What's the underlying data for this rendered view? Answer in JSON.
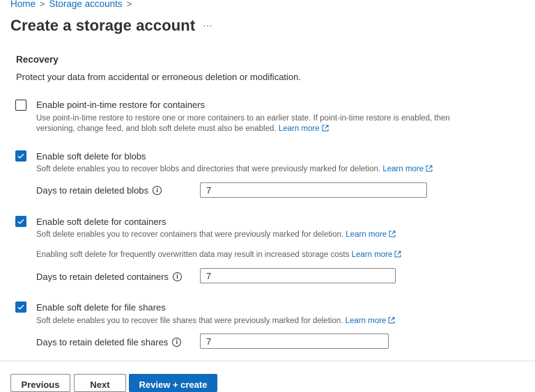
{
  "breadcrumb": {
    "home": "Home",
    "storage": "Storage accounts"
  },
  "page": {
    "title": "Create a storage account",
    "more": "···"
  },
  "recovery": {
    "title": "Recovery",
    "description": "Protect your data from accidental or erroneous deletion or modification.",
    "pitr": {
      "label": "Enable point-in-time restore for containers",
      "checked": false,
      "help": "Use point-in-time restore to restore one or more containers to an earlier state. If point-in-time restore is enabled, then versioning, change feed, and blob soft delete must also be enabled.",
      "learn_more": "Learn more"
    },
    "blobs": {
      "label": "Enable soft delete for blobs",
      "checked": true,
      "help": "Soft delete enables you to recover blobs and directories that were previously marked for deletion.",
      "learn_more": "Learn more",
      "days_label": "Days to retain deleted blobs",
      "days_value": "7"
    },
    "containers": {
      "label": "Enable soft delete for containers",
      "checked": true,
      "help": "Soft delete enables you to recover containers that were previously marked for deletion.",
      "learn_more": "Learn more",
      "cost_note": "Enabling soft delete for frequently overwritten data may result in increased storage costs",
      "cost_learn_more": "Learn more",
      "days_label": "Days to retain deleted containers",
      "days_value": "7"
    },
    "fileshares": {
      "label": "Enable soft delete for file shares",
      "checked": true,
      "help": "Soft delete enables you to recover file shares that were previously marked for deletion.",
      "learn_more": "Learn more",
      "days_label": "Days to retain deleted file shares",
      "days_value": "7"
    }
  },
  "footer": {
    "previous": "Previous",
    "next": "Next",
    "review": "Review + create"
  },
  "colors": {
    "accent": "#0f6cbd",
    "text": "#323130",
    "subtext": "#605e5c"
  }
}
